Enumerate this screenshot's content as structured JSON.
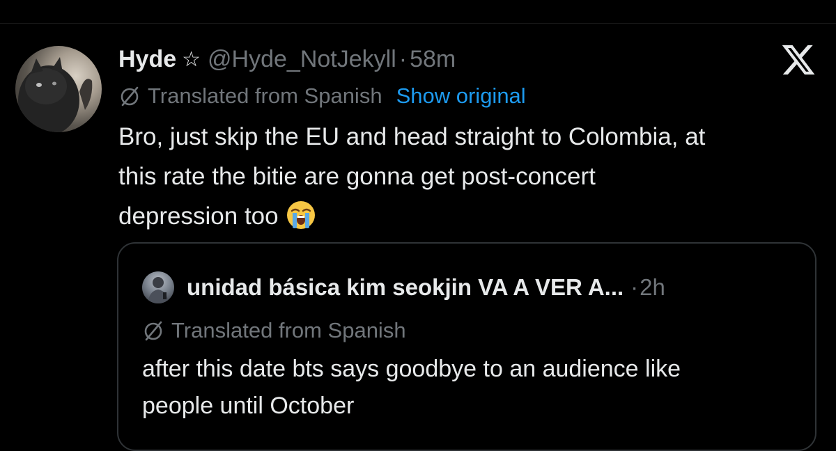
{
  "tweet": {
    "display_name": "Hyde",
    "star_glyph": "☆",
    "handle": "@Hyde_NotJekyll",
    "separator": "·",
    "time": "58m",
    "translated_label": "Translated from Spanish",
    "show_original_label": "Show original",
    "text_lines": [
      "Bro, just skip the EU and head straight to Colombia, at",
      "this rate the bitie are gonna get post-concert",
      "depression too"
    ],
    "emoji_name": "loudly-crying-face-emoji"
  },
  "quote": {
    "display_name": "unidad básica kim seokjin VA A VER A...",
    "separator": "·",
    "time": "2h",
    "translated_label": "Translated from Spanish",
    "text_lines": [
      "after this date bts says goodbye to an audience like",
      "people until October"
    ]
  },
  "icons": {
    "close": "x-logo-icon",
    "translate": "translate-icon",
    "star": "star-icon"
  },
  "colors": {
    "background": "#000000",
    "primary_text": "#e7e9ea",
    "secondary_text": "#71767b",
    "link": "#1d9bf0",
    "border": "#2f3336"
  }
}
